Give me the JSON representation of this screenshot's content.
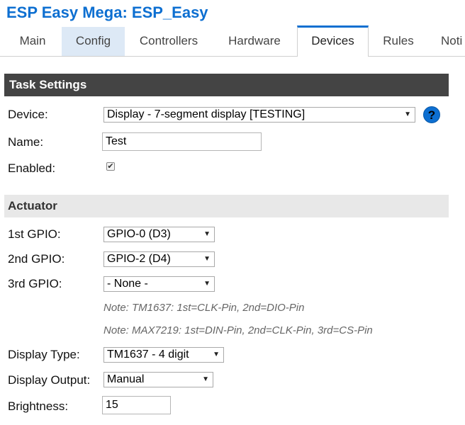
{
  "header": {
    "title": "ESP Easy Mega: ESP_Easy"
  },
  "tabs": [
    {
      "label": "Main"
    },
    {
      "label": "Config"
    },
    {
      "label": "Controllers"
    },
    {
      "label": "Hardware"
    },
    {
      "label": "Devices"
    },
    {
      "label": "Rules"
    },
    {
      "label": "Noti"
    }
  ],
  "task_settings": {
    "heading": "Task Settings",
    "device_label": "Device:",
    "device_value": "Display - 7-segment display [TESTING]",
    "help_symbol": "?",
    "name_label": "Name:",
    "name_value": "Test",
    "enabled_label": "Enabled:",
    "enabled_mark": "✔"
  },
  "actuator": {
    "heading": "Actuator",
    "gpio1_label": "1st GPIO:",
    "gpio1_value": "GPIO-0 (D3)",
    "gpio2_label": "2nd GPIO:",
    "gpio2_value": "GPIO-2 (D4)",
    "gpio3_label": "3rd GPIO:",
    "gpio3_value": "- None -",
    "note1": "Note: TM1637: 1st=CLK-Pin, 2nd=DIO-Pin",
    "note2": "Note: MAX7219: 1st=DIN-Pin, 2nd=CLK-Pin, 3rd=CS-Pin",
    "display_type_label": "Display Type:",
    "display_type_value": "TM1637 - 4 digit",
    "display_output_label": "Display Output:",
    "display_output_value": "Manual",
    "brightness_label": "Brightness:",
    "brightness_value": "15"
  }
}
